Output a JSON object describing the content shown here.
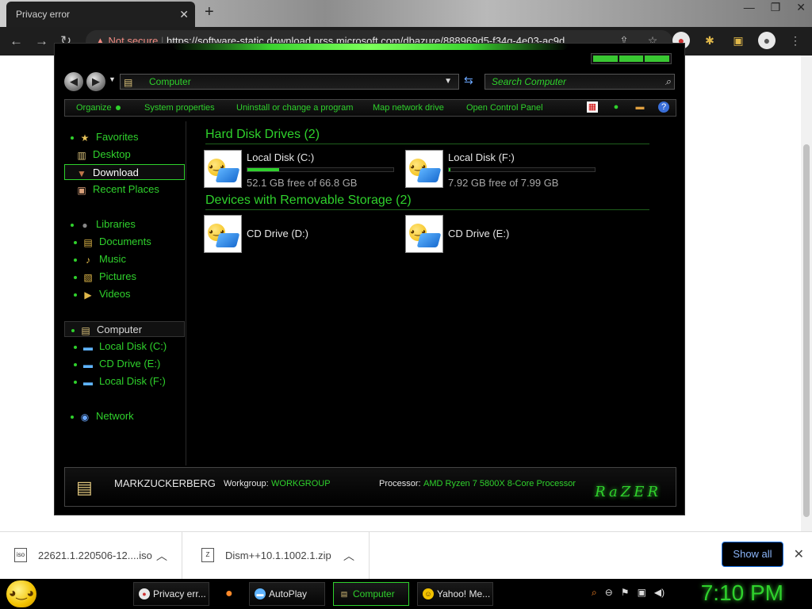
{
  "browser": {
    "tab_title": "Privacy error",
    "url_warning": "Not secure",
    "url_text": "https://software-static.download.prss.microsoft.com/dbazure/888969d5-f34g-4e03-ac9d"
  },
  "explorer": {
    "address": "Computer",
    "search_placeholder": "Search Computer",
    "commands": [
      "Organize",
      "System properties",
      "Uninstall or change a program",
      "Map network drive",
      "Open Control Panel"
    ],
    "sidebar": {
      "favorites": "Favorites",
      "desktop": "Desktop",
      "downloads": "Download",
      "recent": "Recent Places",
      "libraries": "Libraries",
      "documents": "Documents",
      "music": "Music",
      "pictures": "Pictures",
      "videos": "Videos",
      "computer": "Computer",
      "local_c": "Local Disk (C:)",
      "cd_e": "CD Drive (E:)",
      "local_f": "Local Disk (F:)",
      "network": "Network"
    },
    "groups": {
      "hdd": "Hard Disk Drives (2)",
      "removable": "Devices with Removable Storage (2)"
    },
    "drives": [
      {
        "name": "Local Disk (C:)",
        "free": "52.1 GB free of 66.8 GB",
        "used_fraction": 0.22
      },
      {
        "name": "Local Disk (F:)",
        "free": "7.92 GB free of 7.99 GB",
        "used_fraction": 0.01
      },
      {
        "name": "CD Drive (D:)"
      },
      {
        "name": "CD Drive (E:)"
      }
    ],
    "details": {
      "computer_name": "MARKZUCKERBERG",
      "workgroup_label": "Workgroup:",
      "workgroup": "WORKGROUP",
      "processor_label": "Processor:",
      "processor": "AMD Ryzen 7 5800X 8-Core Processor",
      "brand": "RaZER"
    }
  },
  "downloads": {
    "items": [
      {
        "name": "22621.1.220506-12....iso",
        "icon": "iso"
      },
      {
        "name": "Dism++10.1.1002.1.zip",
        "icon": "Z"
      }
    ],
    "show_all": "Show all"
  },
  "taskbar": {
    "tasks": [
      "Privacy err...",
      "AutoPlay",
      "Computer",
      "Yahoo! Me..."
    ],
    "clock": "7:10 PM"
  },
  "colors": {
    "accent": "#2fd12c",
    "background": "#000000"
  }
}
